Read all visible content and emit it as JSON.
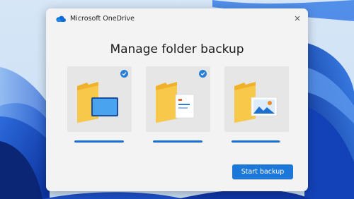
{
  "window": {
    "title": "Microsoft OneDrive",
    "app_icon": "onedrive-cloud-icon",
    "close_icon": "close-icon"
  },
  "main": {
    "heading": "Manage folder backup"
  },
  "folders": [
    {
      "icon": "desktop-folder-icon",
      "selected": true,
      "progress": 1.0
    },
    {
      "icon": "documents-folder-icon",
      "selected": true,
      "progress": 1.0
    },
    {
      "icon": "pictures-folder-icon",
      "selected": false,
      "progress": 0.97
    }
  ],
  "actions": {
    "start_backup_label": "Start backup"
  },
  "colors": {
    "accent": "#1c78d8",
    "folder_yellow": "#f2b630",
    "dialog_bg": "#f3f3f3",
    "tile_bg": "#e6e6e6"
  }
}
